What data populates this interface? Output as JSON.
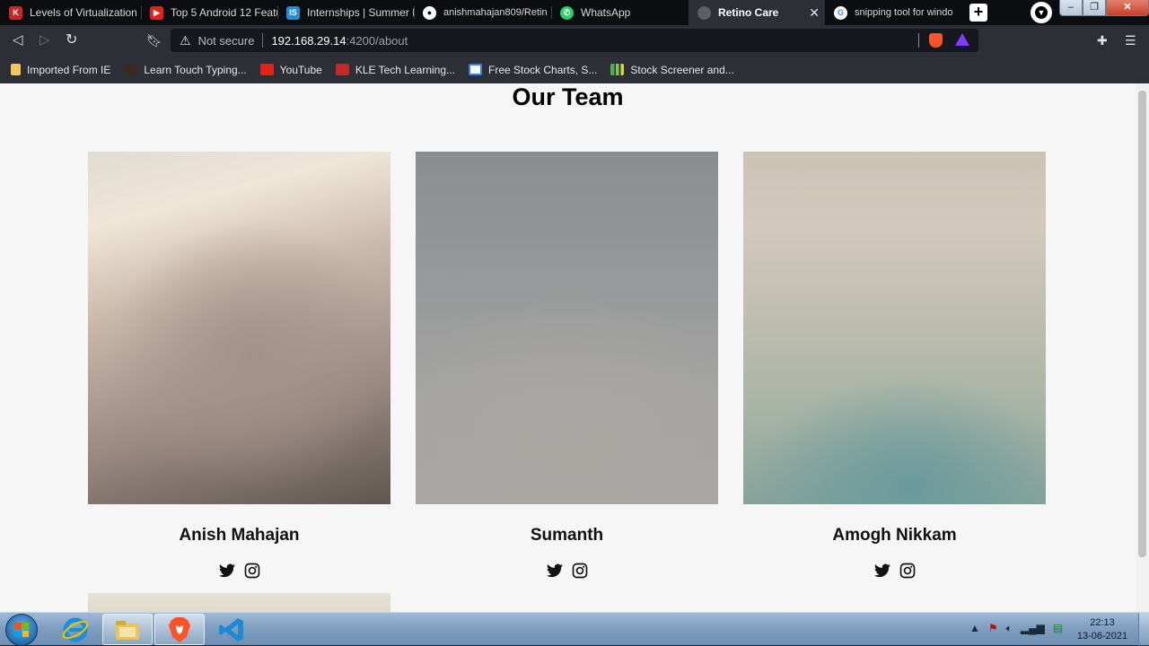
{
  "browser": {
    "tabs": [
      {
        "title": "Levels of Virtualization",
        "icon": "kle-tech-favicon-icon",
        "active": false
      },
      {
        "title": "Top 5 Android 12 Featu",
        "icon": "youtube-favicon-icon",
        "active": false
      },
      {
        "title": "Internships | Summer In",
        "icon": "internshala-favicon-icon",
        "active": false
      },
      {
        "title": "anishmahajan809/Retin",
        "icon": "github-favicon-icon",
        "active": false
      },
      {
        "title": "WhatsApp",
        "icon": "whatsapp-favicon-icon",
        "active": false
      },
      {
        "title": "Retino Care",
        "icon": "globe-favicon-icon",
        "active": true
      },
      {
        "title": "snipping tool for windo",
        "icon": "google-favicon-icon",
        "active": false
      }
    ],
    "new_tab": "+",
    "address": {
      "security_label": "Not secure",
      "host": "192.168.29.14",
      "path": ":4200/about"
    },
    "bookmarks": [
      {
        "label": "Imported From IE",
        "icon": "folder-icon"
      },
      {
        "label": "Learn Touch Typing...",
        "icon": "typing-icon"
      },
      {
        "label": "YouTube",
        "icon": "youtube-icon"
      },
      {
        "label": "KLE Tech Learning...",
        "icon": "kle-tech-icon"
      },
      {
        "label": "Free Stock Charts, S...",
        "icon": "stockcharts-icon"
      },
      {
        "label": "Stock Screener and...",
        "icon": "chart-bars-icon"
      }
    ]
  },
  "page": {
    "heading": "Our Team",
    "members": [
      {
        "name": "Anish Mahajan"
      },
      {
        "name": "Sumanth"
      },
      {
        "name": "Amogh Nikkam"
      }
    ]
  },
  "taskbar": {
    "time": "22:13",
    "date": "13-06-2021",
    "pinned": [
      "internet-explorer-icon",
      "file-explorer-icon",
      "brave-icon",
      "vscode-icon"
    ]
  }
}
